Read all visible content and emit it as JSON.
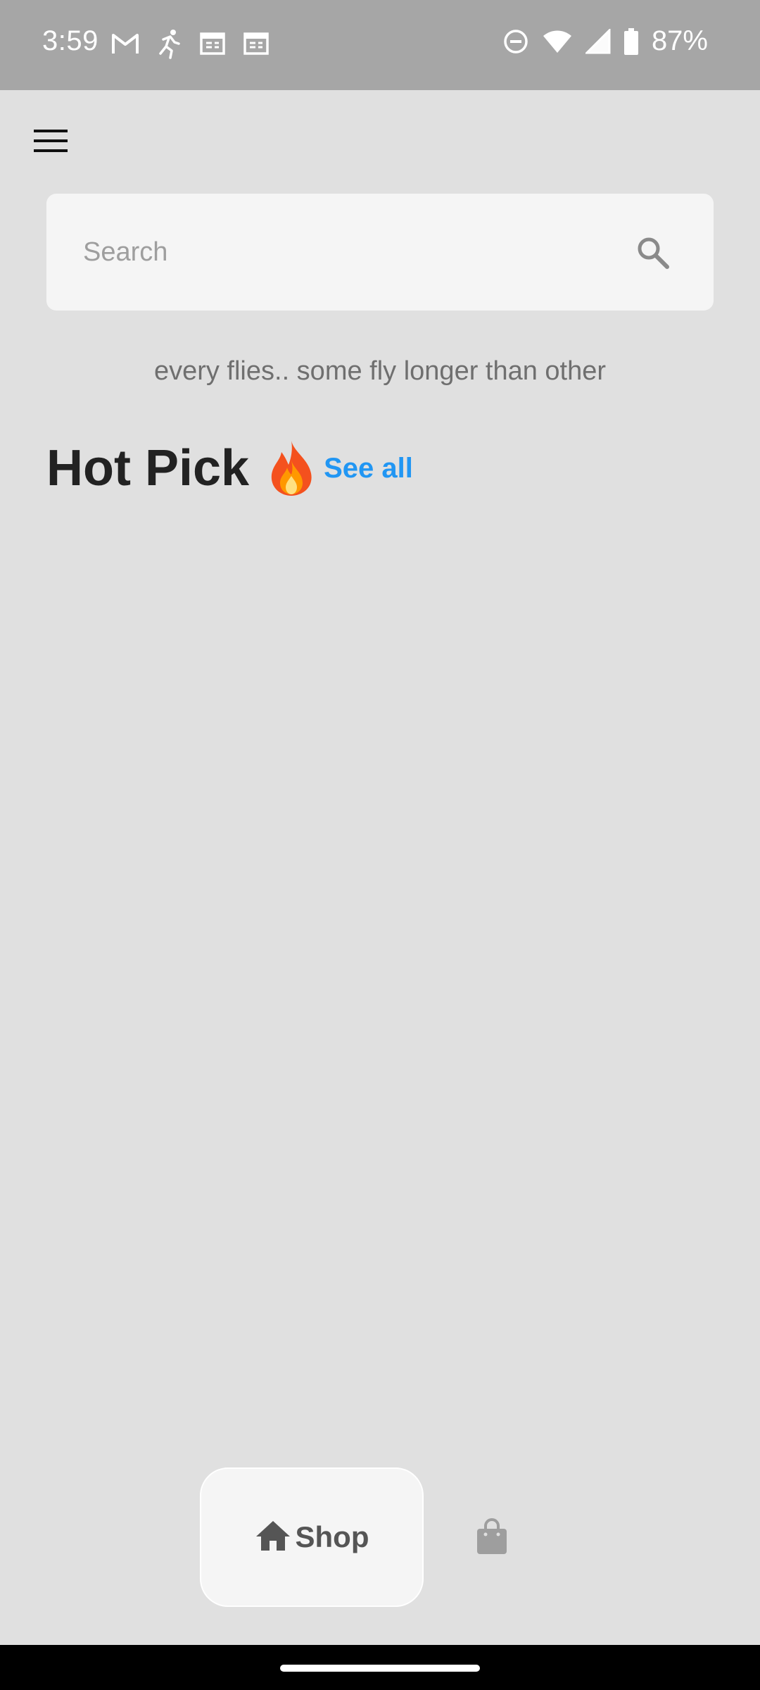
{
  "status_bar": {
    "time": "3:59",
    "battery": "87%",
    "left_icons": [
      "gmail-icon",
      "running-icon",
      "calendar-icon",
      "calendar-icon"
    ],
    "right_icons": [
      "do-not-disturb-icon",
      "wifi-icon",
      "signal-icon",
      "battery-icon"
    ]
  },
  "header": {
    "menu_icon": "hamburger-menu-icon"
  },
  "search": {
    "placeholder": "Search",
    "value": "",
    "icon": "search-icon"
  },
  "tagline": "every flies.. some fly longer than other",
  "hot_pick": {
    "title": "Hot Pick",
    "icon": "fire-icon",
    "see_all_label": "See all"
  },
  "bottom_nav": {
    "shop_label": "Shop",
    "shop_icon": "home-icon",
    "bag_icon": "shopping-bag-icon"
  },
  "colors": {
    "background": "#e0e0e0",
    "status_bar": "#a6a6a6",
    "accent": "#2196f3",
    "card": "#f5f5f5"
  }
}
